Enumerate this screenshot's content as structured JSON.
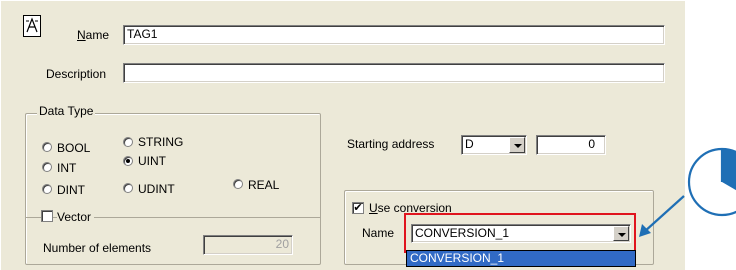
{
  "name": {
    "label": "Name",
    "value": "TAG1"
  },
  "description": {
    "label": "Description",
    "value": ""
  },
  "data_type": {
    "legend": "Data Type",
    "options": [
      "BOOL",
      "STRING",
      "INT",
      "UINT",
      "DINT",
      "UDINT",
      "REAL"
    ],
    "selected": "UINT"
  },
  "vector": {
    "label": "Vector",
    "checked": false
  },
  "num_elements": {
    "label": "Number of elements",
    "value": "20"
  },
  "starting_address": {
    "label": "Starting address",
    "device": "D",
    "value": "0"
  },
  "conversion": {
    "use_label": "Use conversion",
    "checked": true,
    "name_label": "Name",
    "selected": "CONVERSION_1",
    "list_item": "CONVERSION_1"
  },
  "colors": {
    "highlight_box": "#e0141e",
    "arrow": "#1f6fb5",
    "selection": "#316ac5"
  }
}
